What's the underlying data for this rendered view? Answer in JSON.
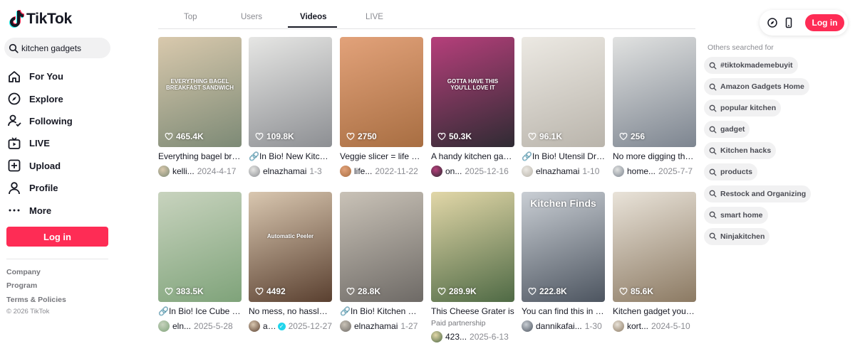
{
  "app": {
    "name": "TikTok"
  },
  "search": {
    "value": "kitchen gadgets"
  },
  "nav": [
    {
      "label": "For You",
      "icon": "home-icon"
    },
    {
      "label": "Explore",
      "icon": "compass-icon"
    },
    {
      "label": "Following",
      "icon": "following-icon"
    },
    {
      "label": "LIVE",
      "icon": "live-icon"
    },
    {
      "label": "Upload",
      "icon": "upload-icon"
    },
    {
      "label": "Profile",
      "icon": "profile-icon"
    },
    {
      "label": "More",
      "icon": "more-icon"
    }
  ],
  "login_label": "Log in",
  "footer": {
    "links": [
      "Company",
      "Program",
      "Terms & Policies"
    ],
    "copyright": "© 2026 TikTok"
  },
  "tabs": [
    {
      "label": "Top",
      "active": false
    },
    {
      "label": "Users",
      "active": false
    },
    {
      "label": "Videos",
      "active": true
    },
    {
      "label": "LIVE",
      "active": false
    }
  ],
  "videos": [
    {
      "likes": "465.4K",
      "caption": "Everything bagel breakfast sandwich",
      "user": "kelli...",
      "date": "2024-4-17",
      "overlay": "EVERYTHING BAGEL\nBREAKFAST SANDWICH",
      "colors": [
        "#7d8a76",
        "#d9c9ad"
      ]
    },
    {
      "likes": "109.8K",
      "caption": "🔗In Bio! New Kitchen gadget",
      "user": "elnazhamai",
      "date": "1-3",
      "overlay": "",
      "colors": [
        "#8d8f93",
        "#e6e6e4"
      ]
    },
    {
      "likes": "2750",
      "caption": "Veggie slicer = life changer",
      "user": "life...",
      "date": "2022-11-22",
      "overlay": "",
      "colors": [
        "#a86e42",
        "#e2a27a"
      ]
    },
    {
      "likes": "50.3K",
      "caption": "A handy kitchen gadget",
      "user": "on...",
      "date": "2025-12-16",
      "overlay": "GOTTA HAVE THIS\nYOU'LL LOVE IT",
      "colors": [
        "#2f2b33",
        "#b63f7b"
      ]
    },
    {
      "likes": "96.1K",
      "caption": "🔗In Bio! Utensil Drying Rack",
      "user": "elnazhamai",
      "date": "1-10",
      "overlay": "",
      "colors": [
        "#b9b4ab",
        "#ece9e3"
      ]
    },
    {
      "likes": "256",
      "caption": "No more digging through",
      "user": "home...",
      "date": "2025-7-7",
      "overlay": "",
      "colors": [
        "#7d8590",
        "#e1e2e1"
      ]
    },
    {
      "likes": "383.5K",
      "caption": "🔗In Bio! Ice Cube Maker",
      "user": "eln...",
      "date": "2025-5-28",
      "overlay": "",
      "colors": [
        "#7fa37a",
        "#c8d3be"
      ]
    },
    {
      "likes": "4492",
      "caption": "No mess, no hassle, just",
      "user": "a...",
      "date": "2025-12-27",
      "overlay": "Automatic Peeler",
      "colors": [
        "#5a4030",
        "#d9c7b0"
      ],
      "verified": true
    },
    {
      "likes": "28.8K",
      "caption": "🔗In Bio! Kitchen Must have",
      "user": "elnazhamai",
      "date": "1-27",
      "overlay": "",
      "colors": [
        "#6e6a66",
        "#c9c2b7"
      ]
    },
    {
      "likes": "289.9K",
      "caption": "This Cheese Grater is",
      "paid": "Paid partnership",
      "user": "423...",
      "date": "2025-6-13",
      "overlay": "",
      "colors": [
        "#4f6a45",
        "#e2d7a8"
      ]
    },
    {
      "likes": "222.8K",
      "caption": "You can find this in the",
      "user": "dannikafai...",
      "date": "1-30",
      "overlay": "Kitchen Finds",
      "colors": [
        "#4d5560",
        "#c9ced4"
      ]
    },
    {
      "likes": "85.6K",
      "caption": "Kitchen gadget you need",
      "user": "kort...",
      "date": "2024-5-10",
      "overlay": "",
      "colors": [
        "#8c7a63",
        "#e9e3d9"
      ]
    }
  ],
  "others_searched": {
    "title": "Others searched for",
    "items": [
      "#tiktokmademebuyit",
      "Amazon Gadgets Home",
      "popular kitchen",
      "gadget",
      "Kitchen hacks",
      "products",
      "Restock and Organizing",
      "smart home",
      "Ninjakitchen"
    ]
  },
  "colors": {
    "accent": "#fe2c55"
  }
}
